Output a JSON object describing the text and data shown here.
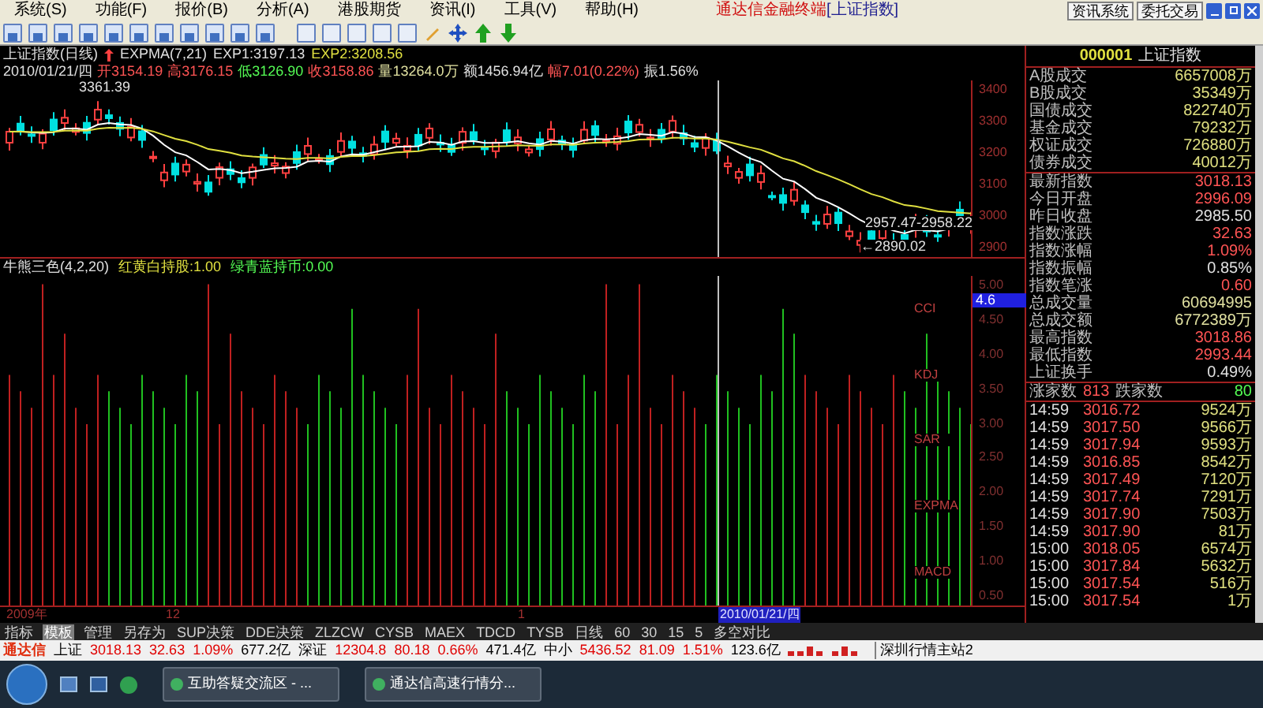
{
  "window": {
    "app_title": "通达信金融终端",
    "doc_title": "[上证指数]"
  },
  "menu": [
    "系统(S)",
    "功能(F)",
    "报价(B)",
    "分析(A)",
    "港股期货",
    "资讯(I)",
    "工具(V)",
    "帮助(H)"
  ],
  "top_buttons": [
    "资讯系统",
    "委托交易"
  ],
  "chart": {
    "title": "上证指数(日线)",
    "indicator": "EXPMA(7,21)",
    "exp1": "EXP1:3197.13",
    "exp2": "EXP2:3208.56",
    "quote_line": [
      {
        "text": "2010/01/21/四",
        "color": "#e0e0e0"
      },
      {
        "text": "开3154.19",
        "color": "#ff5454"
      },
      {
        "text": "高3176.15",
        "color": "#ff5454"
      },
      {
        "text": "低3126.90",
        "color": "#54fc54"
      },
      {
        "text": "收3158.86",
        "color": "#ff5454"
      },
      {
        "text": "量13264.0万",
        "color": "#e0e0a0"
      },
      {
        "text": "额1456.94亿",
        "color": "#e0e0e0"
      },
      {
        "text": "幅7.01(0.22%)",
        "color": "#ff5454"
      },
      {
        "text": "振1.56%",
        "color": "#e0e0e0"
      }
    ],
    "price_labels": [
      "3400",
      "3300",
      "3200",
      "3100",
      "3000",
      "2900"
    ],
    "high_mark": "3361.39",
    "low_mark": "←2890.02",
    "range_mark": "2957.47-2958.22"
  },
  "indicator": {
    "title": "牛熊三色(4,2,20)",
    "hold": "红黄白持股:1.00",
    "cash": "绿青蓝持币:0.00",
    "axis_labels": [
      "5.00",
      "4.50",
      "4.00",
      "3.50",
      "3.00",
      "2.50",
      "2.00",
      "1.50",
      "1.00",
      "0.50"
    ],
    "cursor_value": "4.6",
    "tags": [
      "CCI",
      "KDJ",
      "SAR",
      "EXPMA",
      "MACD"
    ]
  },
  "date_axis": {
    "labels": [
      "2009年",
      "12",
      "1"
    ],
    "cursor_date": "2010/01/21/四"
  },
  "quote_panel": {
    "code": "000001",
    "name": "上证指数",
    "volumes": [
      {
        "label": "A股成交",
        "value": "6657008万"
      },
      {
        "label": "B股成交",
        "value": "35349万"
      },
      {
        "label": "国债成交",
        "value": "822740万"
      },
      {
        "label": "基金成交",
        "value": "79232万"
      },
      {
        "label": "权证成交",
        "value": "726880万"
      },
      {
        "label": "债券成交",
        "value": "40012万"
      }
    ],
    "stats": [
      {
        "label": "最新指数",
        "value": "3018.13",
        "color": "#ff5454"
      },
      {
        "label": "今日开盘",
        "value": "2996.09",
        "color": "#ff5454"
      },
      {
        "label": "昨日收盘",
        "value": "2985.50",
        "color": "#e0e0e0"
      },
      {
        "label": "指数涨跌",
        "value": "32.63",
        "color": "#ff5454"
      },
      {
        "label": "指数涨幅",
        "value": "1.09%",
        "color": "#ff5454"
      },
      {
        "label": "指数振幅",
        "value": "0.85%",
        "color": "#e0e0e0"
      },
      {
        "label": "指数笔涨",
        "value": "0.60",
        "color": "#ff5454"
      },
      {
        "label": "总成交量",
        "value": "60694995",
        "color": "#e0e0a0"
      },
      {
        "label": "总成交额",
        "value": "6772389万",
        "color": "#e0e0a0"
      },
      {
        "label": "最高指数",
        "value": "3018.86",
        "color": "#ff5454"
      },
      {
        "label": "最低指数",
        "value": "2993.44",
        "color": "#ff5454"
      },
      {
        "label": "上证换手",
        "value": "0.49%",
        "color": "#e0e0e0"
      }
    ],
    "advancers_label": "涨家数",
    "advancers": "813",
    "decliners_label": "跌家数",
    "decliners": "80",
    "trades": [
      {
        "time": "14:59",
        "price": "3016.72",
        "volume": "9524万"
      },
      {
        "time": "14:59",
        "price": "3017.50",
        "volume": "9566万"
      },
      {
        "time": "14:59",
        "price": "3017.94",
        "volume": "9593万"
      },
      {
        "time": "14:59",
        "price": "3016.85",
        "volume": "8542万"
      },
      {
        "time": "14:59",
        "price": "3017.49",
        "volume": "7120万"
      },
      {
        "time": "14:59",
        "price": "3017.74",
        "volume": "7291万"
      },
      {
        "time": "14:59",
        "price": "3017.90",
        "volume": "7503万"
      },
      {
        "time": "14:59",
        "price": "3017.90",
        "volume": "81万"
      },
      {
        "time": "15:00",
        "price": "3018.05",
        "volume": "6574万"
      },
      {
        "time": "15:00",
        "price": "3017.84",
        "volume": "5632万"
      },
      {
        "time": "15:00",
        "price": "3017.54",
        "volume": "516万"
      },
      {
        "time": "15:00",
        "price": "3017.54",
        "volume": "1万"
      }
    ]
  },
  "bottom_tabs": [
    {
      "label": "指标",
      "selected": false
    },
    {
      "label": "模板",
      "selected": true
    },
    {
      "label": "管理",
      "selected": false
    },
    {
      "label": "另存为",
      "selected": false
    },
    {
      "label": "SUP决策",
      "selected": false
    },
    {
      "label": "DDE决策",
      "selected": false
    },
    {
      "label": "ZLZCW",
      "selected": false
    },
    {
      "label": "CYSB",
      "selected": false
    },
    {
      "label": "MAEX",
      "selected": false
    },
    {
      "label": "TDCD",
      "selected": false
    },
    {
      "label": "TYSB",
      "selected": false
    },
    {
      "label": "日线",
      "selected": false
    },
    {
      "label": "60",
      "selected": false
    },
    {
      "label": "30",
      "selected": false
    },
    {
      "label": "15",
      "selected": false
    },
    {
      "label": "5",
      "selected": false
    },
    {
      "label": "多空对比",
      "selected": false
    }
  ],
  "ticker": {
    "brand": "通达信",
    "items": [
      {
        "text": "上证",
        "color": "#000000"
      },
      {
        "text": "3018.13",
        "color": "#e00000"
      },
      {
        "text": "32.63",
        "color": "#e00000"
      },
      {
        "text": "1.09%",
        "color": "#e00000"
      },
      {
        "text": "677.2亿",
        "color": "#000000"
      },
      {
        "text": "深证",
        "color": "#000000"
      },
      {
        "text": "12304.8",
        "color": "#e00000"
      },
      {
        "text": "80.18",
        "color": "#e00000"
      },
      {
        "text": "0.66%",
        "color": "#e00000"
      },
      {
        "text": "471.4亿",
        "color": "#000000"
      },
      {
        "text": "中小",
        "color": "#000000"
      },
      {
        "text": "5436.52",
        "color": "#e00000"
      },
      {
        "text": "81.09",
        "color": "#e00000"
      },
      {
        "text": "1.51%",
        "color": "#e00000"
      },
      {
        "text": "123.6亿",
        "color": "#000000"
      }
    ],
    "server": "深圳行情主站2"
  },
  "taskbar": {
    "tasks": [
      "互助答疑交流区 - ...",
      "通达信高速行情分..."
    ]
  }
}
